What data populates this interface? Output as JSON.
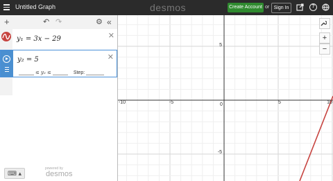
{
  "topbar": {
    "title": "Untitled Graph",
    "brand": "desmos",
    "create_account": "Create Account",
    "or": "or",
    "sign_in": "Sign In",
    "icons": [
      "share-icon",
      "help-icon",
      "language-icon"
    ]
  },
  "panel": {
    "toolbar_icons": [
      "add-icon",
      "undo-icon",
      "redo-icon",
      "settings-icon",
      "collapse-icon"
    ],
    "expressions": [
      {
        "index": "1",
        "latex": "y₁ = 3x − 29"
      },
      {
        "index": "2",
        "latex": "y₂ = 5",
        "slider": {
          "mid": "≤ y₂ ≤",
          "step_label": "Step:"
        }
      },
      {
        "index": "3",
        "latex": ""
      }
    ],
    "footer": {
      "powered_by": "powered by",
      "brand": "desmos"
    }
  },
  "graph": {
    "x_ticks": [
      "-10",
      "-5",
      "0",
      "5",
      "10"
    ],
    "y_ticks": [
      "5",
      "-5"
    ],
    "accent_line": "#c74440"
  },
  "side_buttons": {
    "settings": "🔧",
    "zoom_in": "+",
    "zoom_out": "−"
  }
}
